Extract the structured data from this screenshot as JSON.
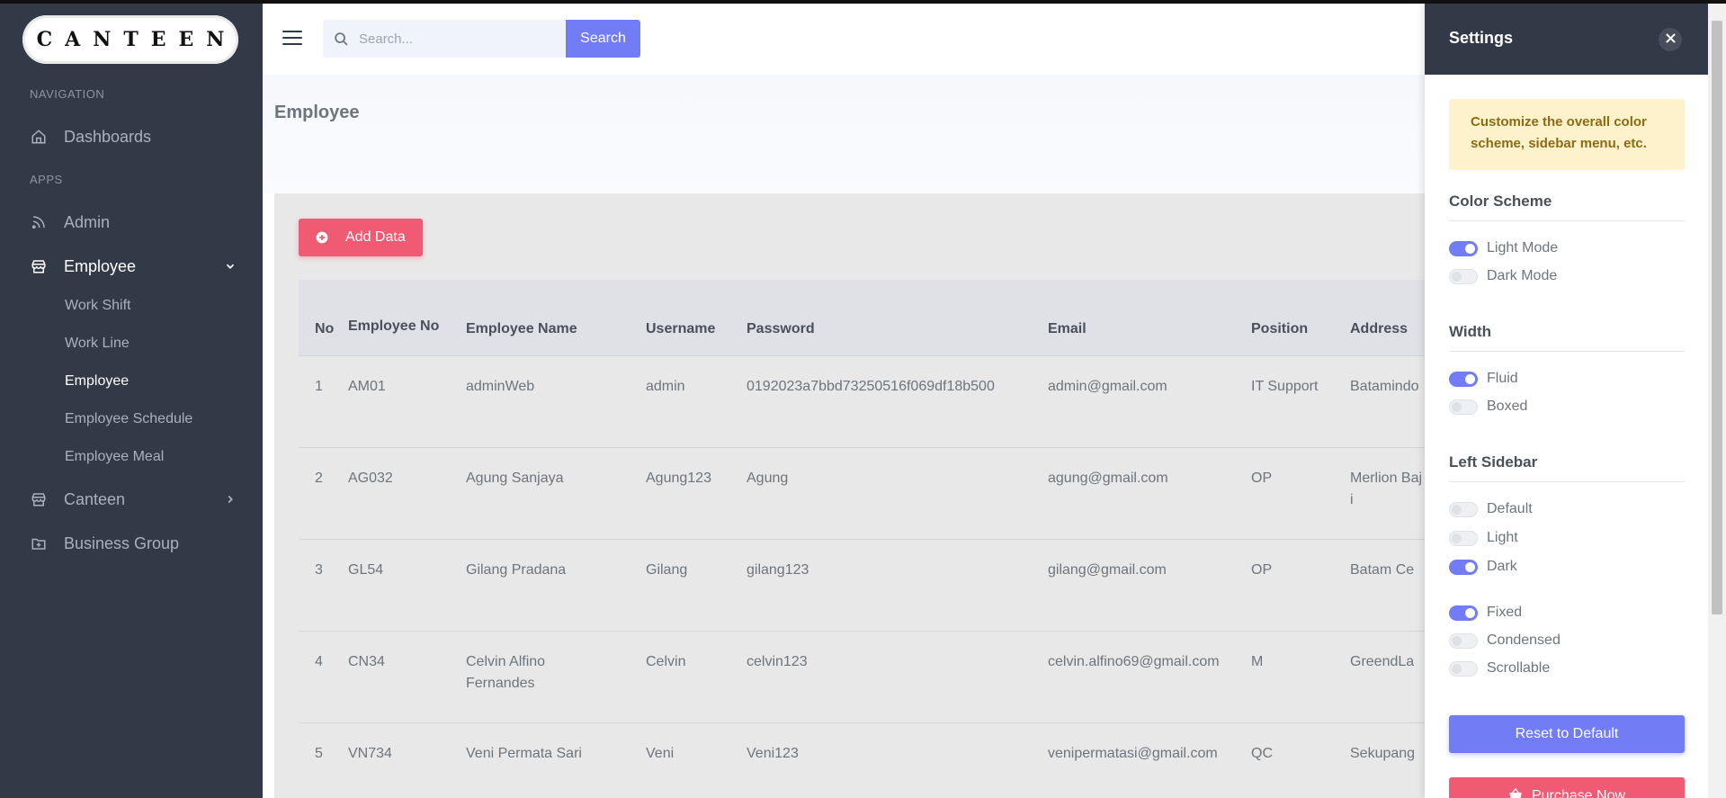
{
  "app": {
    "logo_text": "CANTEEN"
  },
  "sidebar": {
    "sections": [
      {
        "title": "NAVIGATION"
      },
      {
        "title": "APPS"
      }
    ],
    "items": [
      {
        "label": "Dashboards",
        "icon": "home-icon"
      },
      {
        "label": "Admin",
        "icon": "rss-icon"
      },
      {
        "label": "Employee",
        "icon": "store-icon"
      },
      {
        "label": "Canteen",
        "icon": "store-icon"
      },
      {
        "label": "Business Group",
        "icon": "folder-plus-icon"
      }
    ],
    "employee_sub": [
      {
        "label": "Work Shift"
      },
      {
        "label": "Work Line"
      },
      {
        "label": "Employee"
      },
      {
        "label": "Employee Schedule"
      },
      {
        "label": "Employee Meal"
      }
    ]
  },
  "topbar": {
    "search_placeholder": "Search...",
    "search_label": "Search"
  },
  "page": {
    "title": "Employee",
    "add_label": "Add Data"
  },
  "table": {
    "headers": [
      "No",
      "Employee No",
      "Employee Name",
      "Username",
      "Password",
      "Email",
      "Position",
      "Address"
    ],
    "rows": [
      [
        "1",
        "AM01",
        "adminWeb",
        "admin",
        "0192023a7bbd73250516f069df18b500",
        "admin@gmail.com",
        "IT Support",
        "Batamindo"
      ],
      [
        "2",
        "AG032",
        "Agung Sanjaya",
        "Agung123",
        "Agung",
        "agung@gmail.com",
        "OP",
        "Merlion Baji"
      ],
      [
        "3",
        "GL54",
        "Gilang Pradana",
        "Gilang",
        "gilang123",
        "gilang@gmail.com",
        "OP",
        "Batam Ce"
      ],
      [
        "4",
        "CN34",
        "Celvin Alfino Fernandes",
        "Celvin",
        "celvin123",
        "celvin.alfino69@gmail.com",
        "M",
        "GreendLa"
      ],
      [
        "5",
        "VN734",
        "Veni Permata Sari",
        "Veni",
        "Veni123",
        "venipermatasi@gmail.com",
        "QC",
        "Sekupang"
      ]
    ]
  },
  "settings": {
    "title": "Settings",
    "alert": "Customize the overall color scheme, sidebar menu, etc.",
    "color_scheme": {
      "title": "Color Scheme",
      "options": [
        {
          "label": "Light Mode",
          "on": true
        },
        {
          "label": "Dark Mode",
          "on": false
        }
      ]
    },
    "width": {
      "title": "Width",
      "options": [
        {
          "label": "Fluid",
          "on": true
        },
        {
          "label": "Boxed",
          "on": false
        }
      ]
    },
    "left_sidebar": {
      "title": "Left Sidebar",
      "options": [
        {
          "label": "Default",
          "on": false
        },
        {
          "label": "Light",
          "on": false
        },
        {
          "label": "Dark",
          "on": true
        },
        {
          "label": "Fixed",
          "on": true
        },
        {
          "label": "Condensed",
          "on": false
        },
        {
          "label": "Scrollable",
          "on": false
        }
      ]
    },
    "reset_label": "Reset to Default",
    "purchase_label": "Purchase Now"
  },
  "colors": {
    "sidebar_bg": "#313a46",
    "primary": "#727cf5",
    "danger": "#f05a73",
    "content_bg": "#e8e8e8"
  }
}
